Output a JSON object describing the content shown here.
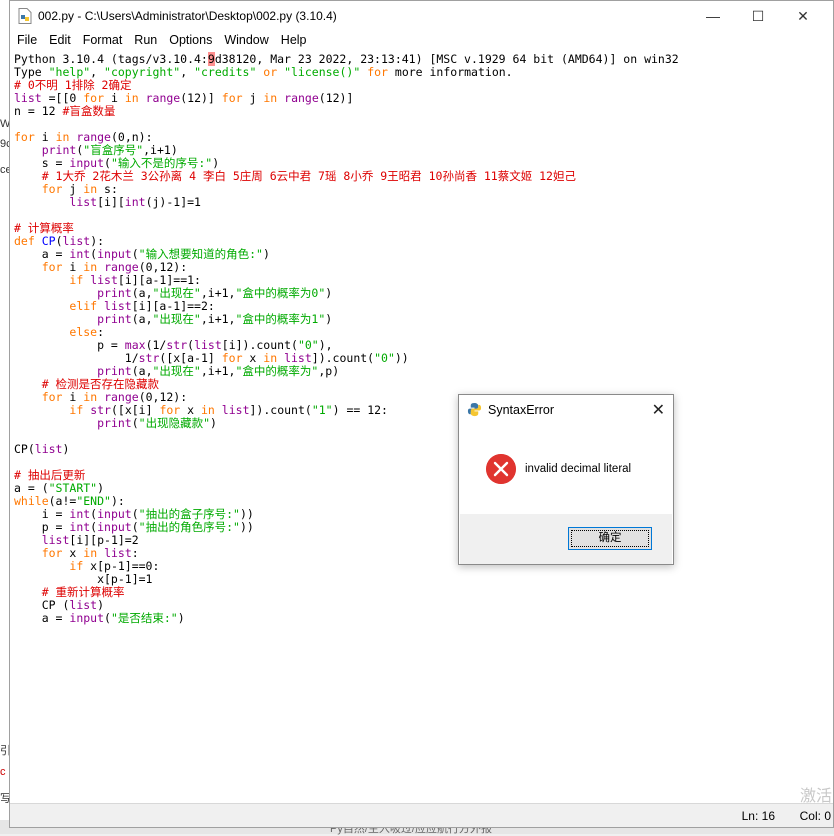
{
  "window": {
    "title": "002.py - C:\\Users\\Administrator\\Desktop\\002.py (3.10.4)",
    "minimize": "—",
    "maximize": "☐",
    "close": "✕"
  },
  "menu": [
    "File",
    "Edit",
    "Format",
    "Run",
    "Options",
    "Window",
    "Help"
  ],
  "editor": {
    "lines": [
      [
        [
          "Python 3.10.4 (tags/v3.10.4:",
          ""
        ],
        [
          "9",
          "cursor-hl"
        ],
        [
          "d38120, Mar 23 2022, 23:13:41) [MSC v.1929 64 bit (AMD64)] on win32",
          ""
        ]
      ],
      [
        [
          "Type ",
          ""
        ],
        [
          "\"help\"",
          "s"
        ],
        [
          ", ",
          ""
        ],
        [
          "\"copyright\"",
          "s"
        ],
        [
          ", ",
          ""
        ],
        [
          "\"credits\"",
          "s"
        ],
        [
          " or ",
          "k"
        ],
        [
          "\"license()\"",
          "s"
        ],
        [
          " ",
          ""
        ],
        [
          "for",
          "k"
        ],
        [
          " more information.",
          ""
        ]
      ],
      [
        [
          "# 0不明 1排除 2确定",
          "c"
        ]
      ],
      [
        [
          "list",
          "b"
        ],
        [
          " =[[0 ",
          ""
        ],
        [
          "for",
          "k"
        ],
        [
          " i ",
          ""
        ],
        [
          "in",
          "k"
        ],
        [
          " ",
          ""
        ],
        [
          "range",
          "b"
        ],
        [
          "(12)] ",
          ""
        ],
        [
          "for",
          "k"
        ],
        [
          " j ",
          ""
        ],
        [
          "in",
          "k"
        ],
        [
          " ",
          ""
        ],
        [
          "range",
          "b"
        ],
        [
          "(12)]",
          ""
        ]
      ],
      [
        [
          "n = 12 ",
          ""
        ],
        [
          "#盲盒数量",
          "c"
        ]
      ],
      [
        [
          "",
          ""
        ]
      ],
      [
        [
          "for",
          "k"
        ],
        [
          " i ",
          ""
        ],
        [
          "in",
          "k"
        ],
        [
          " ",
          ""
        ],
        [
          "range",
          "b"
        ],
        [
          "(0,n):",
          ""
        ]
      ],
      [
        [
          "    ",
          ""
        ],
        [
          "print",
          "b"
        ],
        [
          "(",
          ""
        ],
        [
          "\"盲盒序号\"",
          "s"
        ],
        [
          ",i+1)",
          ""
        ]
      ],
      [
        [
          "    s = ",
          ""
        ],
        [
          "input",
          "b"
        ],
        [
          "(",
          ""
        ],
        [
          "\"输入不是的序号:\"",
          "s"
        ],
        [
          ")",
          ""
        ]
      ],
      [
        [
          "    ",
          ""
        ],
        [
          "# 1大乔 2花木兰 3公孙离 4 李白 5庄周 6云中君 7瑶 8小乔 9王昭君 10孙尚香 11蔡文姬 12妲己",
          "c"
        ]
      ],
      [
        [
          "    ",
          ""
        ],
        [
          "for",
          "k"
        ],
        [
          " j ",
          ""
        ],
        [
          "in",
          "k"
        ],
        [
          " s:",
          ""
        ]
      ],
      [
        [
          "        ",
          ""
        ],
        [
          "list",
          "b"
        ],
        [
          "[i][",
          ""
        ],
        [
          "int",
          "b"
        ],
        [
          "(j)-1]=1",
          ""
        ]
      ],
      [
        [
          "",
          ""
        ]
      ],
      [
        [
          "# 计算概率",
          "c"
        ]
      ],
      [
        [
          "def",
          "k"
        ],
        [
          " ",
          ""
        ],
        [
          "CP",
          "f"
        ],
        [
          "(",
          ""
        ],
        [
          "list",
          "b"
        ],
        [
          "):",
          ""
        ]
      ],
      [
        [
          "    a = ",
          ""
        ],
        [
          "int",
          "b"
        ],
        [
          "(",
          ""
        ],
        [
          "input",
          "b"
        ],
        [
          "(",
          ""
        ],
        [
          "\"输入想要知道的角色:\"",
          "s"
        ],
        [
          ")",
          ""
        ]
      ],
      [
        [
          "    ",
          ""
        ],
        [
          "for",
          "k"
        ],
        [
          " i ",
          ""
        ],
        [
          "in",
          "k"
        ],
        [
          " ",
          ""
        ],
        [
          "range",
          "b"
        ],
        [
          "(0,12):",
          ""
        ]
      ],
      [
        [
          "        ",
          ""
        ],
        [
          "if",
          "k"
        ],
        [
          " ",
          ""
        ],
        [
          "list",
          "b"
        ],
        [
          "[i][a-1]==1:",
          ""
        ]
      ],
      [
        [
          "            ",
          ""
        ],
        [
          "print",
          "b"
        ],
        [
          "(a,",
          ""
        ],
        [
          "\"出现在\"",
          "s"
        ],
        [
          ",i+1,",
          ""
        ],
        [
          "\"盒中的概率为0\"",
          "s"
        ],
        [
          ")",
          ""
        ]
      ],
      [
        [
          "        ",
          ""
        ],
        [
          "elif",
          "k"
        ],
        [
          " ",
          ""
        ],
        [
          "list",
          "b"
        ],
        [
          "[i][a-1]==2:",
          ""
        ]
      ],
      [
        [
          "            ",
          ""
        ],
        [
          "print",
          "b"
        ],
        [
          "(a,",
          ""
        ],
        [
          "\"出现在\"",
          "s"
        ],
        [
          ",i+1,",
          ""
        ],
        [
          "\"盒中的概率为1\"",
          "s"
        ],
        [
          ")",
          ""
        ]
      ],
      [
        [
          "        ",
          ""
        ],
        [
          "else",
          "k"
        ],
        [
          ":",
          ""
        ]
      ],
      [
        [
          "            p = ",
          ""
        ],
        [
          "max",
          "b"
        ],
        [
          "(1/",
          ""
        ],
        [
          "str",
          "b"
        ],
        [
          "(",
          ""
        ],
        [
          "list",
          "b"
        ],
        [
          "[i]).count(",
          ""
        ],
        [
          "\"0\"",
          "s"
        ],
        [
          "),",
          ""
        ]
      ],
      [
        [
          "                1/",
          ""
        ],
        [
          "str",
          "b"
        ],
        [
          "([x[a-1] ",
          ""
        ],
        [
          "for",
          "k"
        ],
        [
          " x ",
          ""
        ],
        [
          "in",
          "k"
        ],
        [
          " ",
          ""
        ],
        [
          "list",
          "b"
        ],
        [
          "]).count(",
          ""
        ],
        [
          "\"0\"",
          "s"
        ],
        [
          "))",
          ""
        ]
      ],
      [
        [
          "            ",
          ""
        ],
        [
          "print",
          "b"
        ],
        [
          "(a,",
          ""
        ],
        [
          "\"出现在\"",
          "s"
        ],
        [
          ",i+1,",
          ""
        ],
        [
          "\"盒中的概率为\"",
          "s"
        ],
        [
          ",p)",
          ""
        ]
      ],
      [
        [
          "    ",
          ""
        ],
        [
          "# 检测是否存在隐藏款",
          "c"
        ]
      ],
      [
        [
          "    ",
          ""
        ],
        [
          "for",
          "k"
        ],
        [
          " i ",
          ""
        ],
        [
          "in",
          "k"
        ],
        [
          " ",
          ""
        ],
        [
          "range",
          "b"
        ],
        [
          "(0,12):",
          ""
        ]
      ],
      [
        [
          "        ",
          ""
        ],
        [
          "if",
          "k"
        ],
        [
          " ",
          ""
        ],
        [
          "str",
          "b"
        ],
        [
          "([x[i] ",
          ""
        ],
        [
          "for",
          "k"
        ],
        [
          " x ",
          ""
        ],
        [
          "in",
          "k"
        ],
        [
          " ",
          ""
        ],
        [
          "list",
          "b"
        ],
        [
          "]).count(",
          ""
        ],
        [
          "\"1\"",
          "s"
        ],
        [
          ") == 12:",
          ""
        ]
      ],
      [
        [
          "            ",
          ""
        ],
        [
          "print",
          "b"
        ],
        [
          "(",
          ""
        ],
        [
          "\"出现隐藏款\"",
          "s"
        ],
        [
          ")",
          ""
        ]
      ],
      [
        [
          "",
          ""
        ]
      ],
      [
        [
          "CP(",
          ""
        ],
        [
          "list",
          "b"
        ],
        [
          ")",
          ""
        ]
      ],
      [
        [
          "",
          ""
        ]
      ],
      [
        [
          "# 抽出后更新",
          "c"
        ]
      ],
      [
        [
          "a = (",
          ""
        ],
        [
          "\"START\"",
          "s"
        ],
        [
          ")",
          ""
        ]
      ],
      [
        [
          "while",
          "k"
        ],
        [
          "(a!=",
          ""
        ],
        [
          "\"END\"",
          "s"
        ],
        [
          "):",
          ""
        ]
      ],
      [
        [
          "    i = ",
          ""
        ],
        [
          "int",
          "b"
        ],
        [
          "(",
          ""
        ],
        [
          "input",
          "b"
        ],
        [
          "(",
          ""
        ],
        [
          "\"抽出的盒子序号:\"",
          "s"
        ],
        [
          "))",
          ""
        ]
      ],
      [
        [
          "    p = ",
          ""
        ],
        [
          "int",
          "b"
        ],
        [
          "(",
          ""
        ],
        [
          "input",
          "b"
        ],
        [
          "(",
          ""
        ],
        [
          "\"抽出的角色序号:\"",
          "s"
        ],
        [
          "))",
          ""
        ]
      ],
      [
        [
          "    ",
          ""
        ],
        [
          "list",
          "b"
        ],
        [
          "[i][p-1]=2",
          ""
        ]
      ],
      [
        [
          "    ",
          ""
        ],
        [
          "for",
          "k"
        ],
        [
          " x ",
          ""
        ],
        [
          "in",
          "k"
        ],
        [
          " ",
          ""
        ],
        [
          "list",
          "b"
        ],
        [
          ":",
          ""
        ]
      ],
      [
        [
          "        ",
          ""
        ],
        [
          "if",
          "k"
        ],
        [
          " x[p-1]==0:",
          ""
        ]
      ],
      [
        [
          "            x[p-1]=1",
          ""
        ]
      ],
      [
        [
          "    ",
          ""
        ],
        [
          "# 重新计算概率",
          "c"
        ]
      ],
      [
        [
          "    CP (",
          ""
        ],
        [
          "list",
          "b"
        ],
        [
          ")",
          ""
        ]
      ],
      [
        [
          "    a = ",
          ""
        ],
        [
          "input",
          "b"
        ],
        [
          "(",
          ""
        ],
        [
          "\"是否结束:\"",
          "s"
        ],
        [
          ")",
          ""
        ]
      ]
    ]
  },
  "status": {
    "line": "Ln: 16",
    "col": "Col: 0"
  },
  "dialog": {
    "title": "SyntaxError",
    "close": "✕",
    "message": "invalid decimal literal",
    "ok_label": "确定"
  },
  "background": {
    "frag1": "W",
    "frag2": "9c",
    "frag3": "ce",
    "frag4": "引",
    "frag5": "c",
    "frag6": "写",
    "bottom_text": "Py自然/主入吸过/应应航行方外报",
    "watermark": "激活"
  },
  "colors": {
    "keyword": "#ff7700",
    "builtin": "#900090",
    "string": "#00aa00",
    "comment": "#dd0000",
    "definition": "#0000ff",
    "error_icon": "#e0342f",
    "button_border": "#0078d7"
  }
}
